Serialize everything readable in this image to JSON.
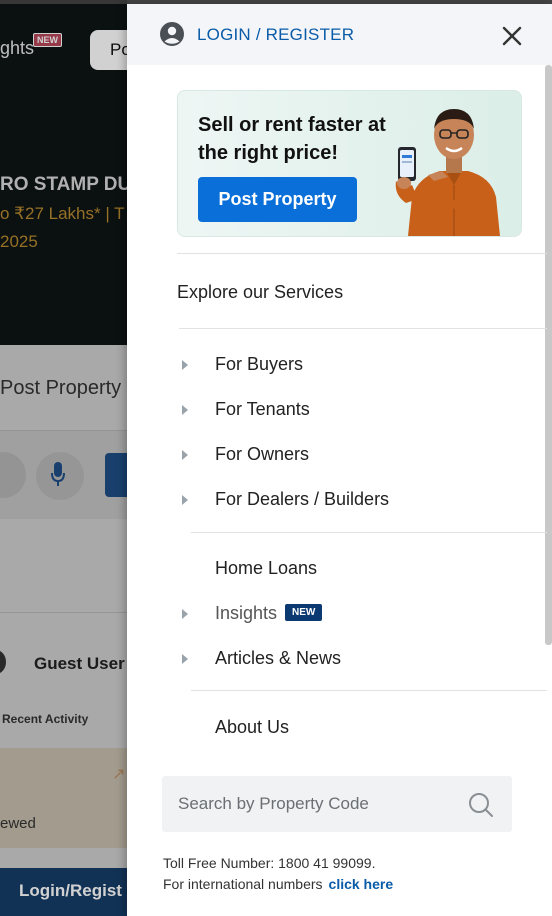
{
  "background": {
    "insights_label": "ghts",
    "insights_badge": "NEW",
    "post_pill": "Po",
    "stamp_text": "RO STAMP DU",
    "lakhs_text": "o ₹27 Lakhs* | T",
    "year_text": "2025",
    "post_property_text": "Post Property",
    "guest_user": "Guest User",
    "recent_activity": "Recent Activity",
    "viewed_text": "ewed",
    "login_register": "Login/Regist"
  },
  "drawer": {
    "login_register": "LOGIN / REGISTER",
    "promo": {
      "title": "Sell or rent faster at the right price!",
      "button": "Post Property"
    },
    "explore_heading": "Explore our Services",
    "menu_items": [
      {
        "label": "For Buyers"
      },
      {
        "label": "For Tenants"
      },
      {
        "label": "For Owners"
      },
      {
        "label": "For Dealers / Builders"
      }
    ],
    "home_loans": "Home Loans",
    "insights": {
      "label": "Insights",
      "badge": "NEW"
    },
    "articles": "Articles & News",
    "about": "About Us",
    "search": {
      "placeholder": "Search by Property Code"
    },
    "tollfree_line": "Toll Free Number: 1800 41 99099.",
    "intl_line": "For international numbers",
    "click_here": "click here"
  },
  "colors": {
    "accent_link": "#0a5ca8",
    "promo_button": "#0a6fd8",
    "badge_bg": "#0b3a73"
  }
}
